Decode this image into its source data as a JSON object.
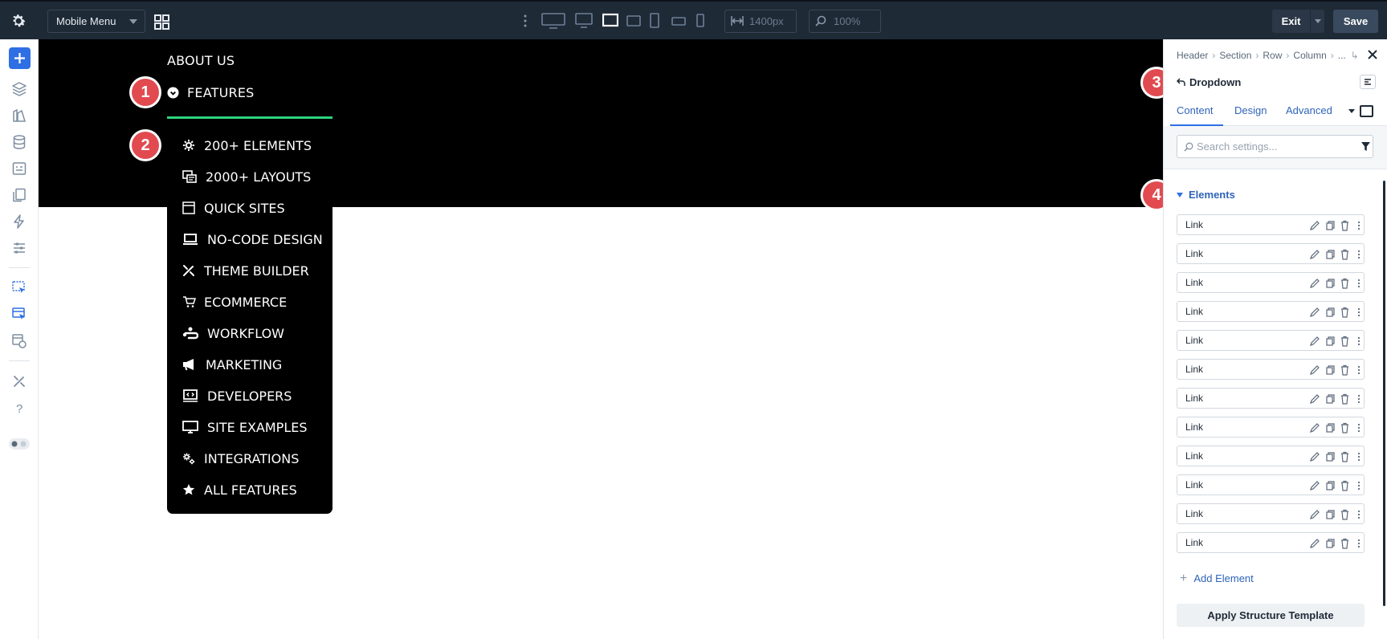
{
  "topbar": {
    "menu_select": "Mobile Menu",
    "width_value": "1400px",
    "zoom_value": "100%",
    "exit_label": "Exit",
    "save_label": "Save"
  },
  "canvas": {
    "nav_about": "ABOUT US",
    "nav_features": "FEATURES",
    "dropdown_items": [
      {
        "label": "200+ ELEMENTS",
        "icon": "gear-icon"
      },
      {
        "label": "2000+ LAYOUTS",
        "icon": "layouts-icon"
      },
      {
        "label": "QUICK SITES",
        "icon": "browser-window-icon"
      },
      {
        "label": "NO-CODE DESIGN",
        "icon": "laptop-icon"
      },
      {
        "label": "THEME BUILDER",
        "icon": "tools-icon"
      },
      {
        "label": "ECOMMERCE",
        "icon": "cart-icon"
      },
      {
        "label": "WORKFLOW",
        "icon": "workflow-icon"
      },
      {
        "label": "MARKETING",
        "icon": "megaphone-icon"
      },
      {
        "label": "DEVELOPERS",
        "icon": "code-screen-icon"
      },
      {
        "label": "SITE EXAMPLES",
        "icon": "monitor-icon"
      },
      {
        "label": "INTEGRATIONS",
        "icon": "gears-icon"
      },
      {
        "label": "ALL FEATURES",
        "icon": "star-icon"
      }
    ]
  },
  "badges": [
    "1",
    "2",
    "3",
    "4"
  ],
  "panel": {
    "breadcrumb": [
      "Header",
      "Section",
      "Row",
      "Column",
      "..."
    ],
    "module_title": "Dropdown",
    "tabs": [
      "Content",
      "Design",
      "Advanced"
    ],
    "active_tab": "Content",
    "search_placeholder": "Search settings...",
    "elements_heading": "Elements",
    "links": [
      "Link",
      "Link",
      "Link",
      "Link",
      "Link",
      "Link",
      "Link",
      "Link",
      "Link",
      "Link",
      "Link",
      "Link"
    ],
    "add_element": "Add Element",
    "apply_template": "Apply Structure Template"
  },
  "colors": {
    "topbar": "#1f2a37",
    "accent_blue": "#2f6fe4",
    "badge_red": "#e14b50",
    "nav_underline": "#2ed37d"
  }
}
